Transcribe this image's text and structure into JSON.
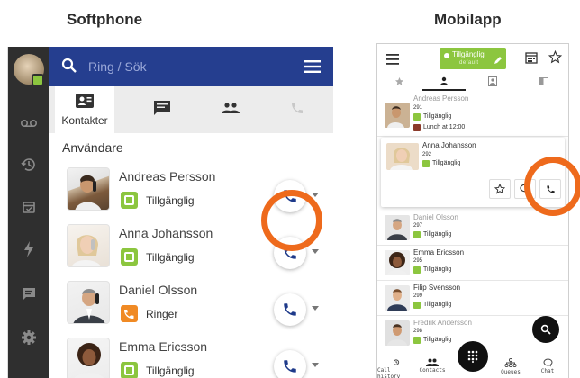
{
  "headings": {
    "softphone": "Softphone",
    "mobile": "Mobilapp"
  },
  "softphone": {
    "search_placeholder": "Ring / Sök",
    "tabs": {
      "contacts_label": "Kontakter"
    },
    "section_title": "Användare",
    "contacts": [
      {
        "name": "Andreas Persson",
        "status": "Tillgänglig",
        "status_color": "#8cc63f"
      },
      {
        "name": "Anna Johansson",
        "status": "Tillgänglig",
        "status_color": "#8cc63f"
      },
      {
        "name": "Daniel  Olsson",
        "status": "Ringer",
        "status_color": "#f08a24"
      },
      {
        "name": "Emma Ericsson",
        "status": "Tillgänglig",
        "status_color": "#8cc63f"
      }
    ],
    "colors": {
      "topbar": "#253e8f",
      "rail": "#2f2f2f",
      "highlight_ring": "#ee6a1c"
    }
  },
  "mobile": {
    "status_button": {
      "label": "Tillgänglig",
      "sub": "default"
    },
    "contacts": [
      {
        "name": "Andreas Persson",
        "ext": "291",
        "status": "Tillgänglig",
        "note_prefix": "Lunch",
        "note_suffix": " at 12:00"
      },
      {
        "name": "Anna Johansson",
        "ext": "292",
        "status": "Tillgänglig"
      },
      {
        "name": "Daniel  Olsson",
        "ext": "297",
        "status": "Tillgänglig"
      },
      {
        "name": "Emma Ericsson",
        "ext": "295",
        "status": "Tillgänglig"
      },
      {
        "name": "Filip Svensson",
        "ext": "299",
        "status": "Tillgänglig"
      },
      {
        "name": "Fredrik Andersson",
        "ext": "298",
        "status": "Tillgänglig"
      }
    ],
    "bottom_nav": {
      "call_history": "Call history",
      "contacts": "Contacts",
      "queues": "Queues",
      "chat": "Chat"
    },
    "colors": {
      "available": "#8cc63f",
      "highlight_ring": "#ee6a1c"
    }
  }
}
